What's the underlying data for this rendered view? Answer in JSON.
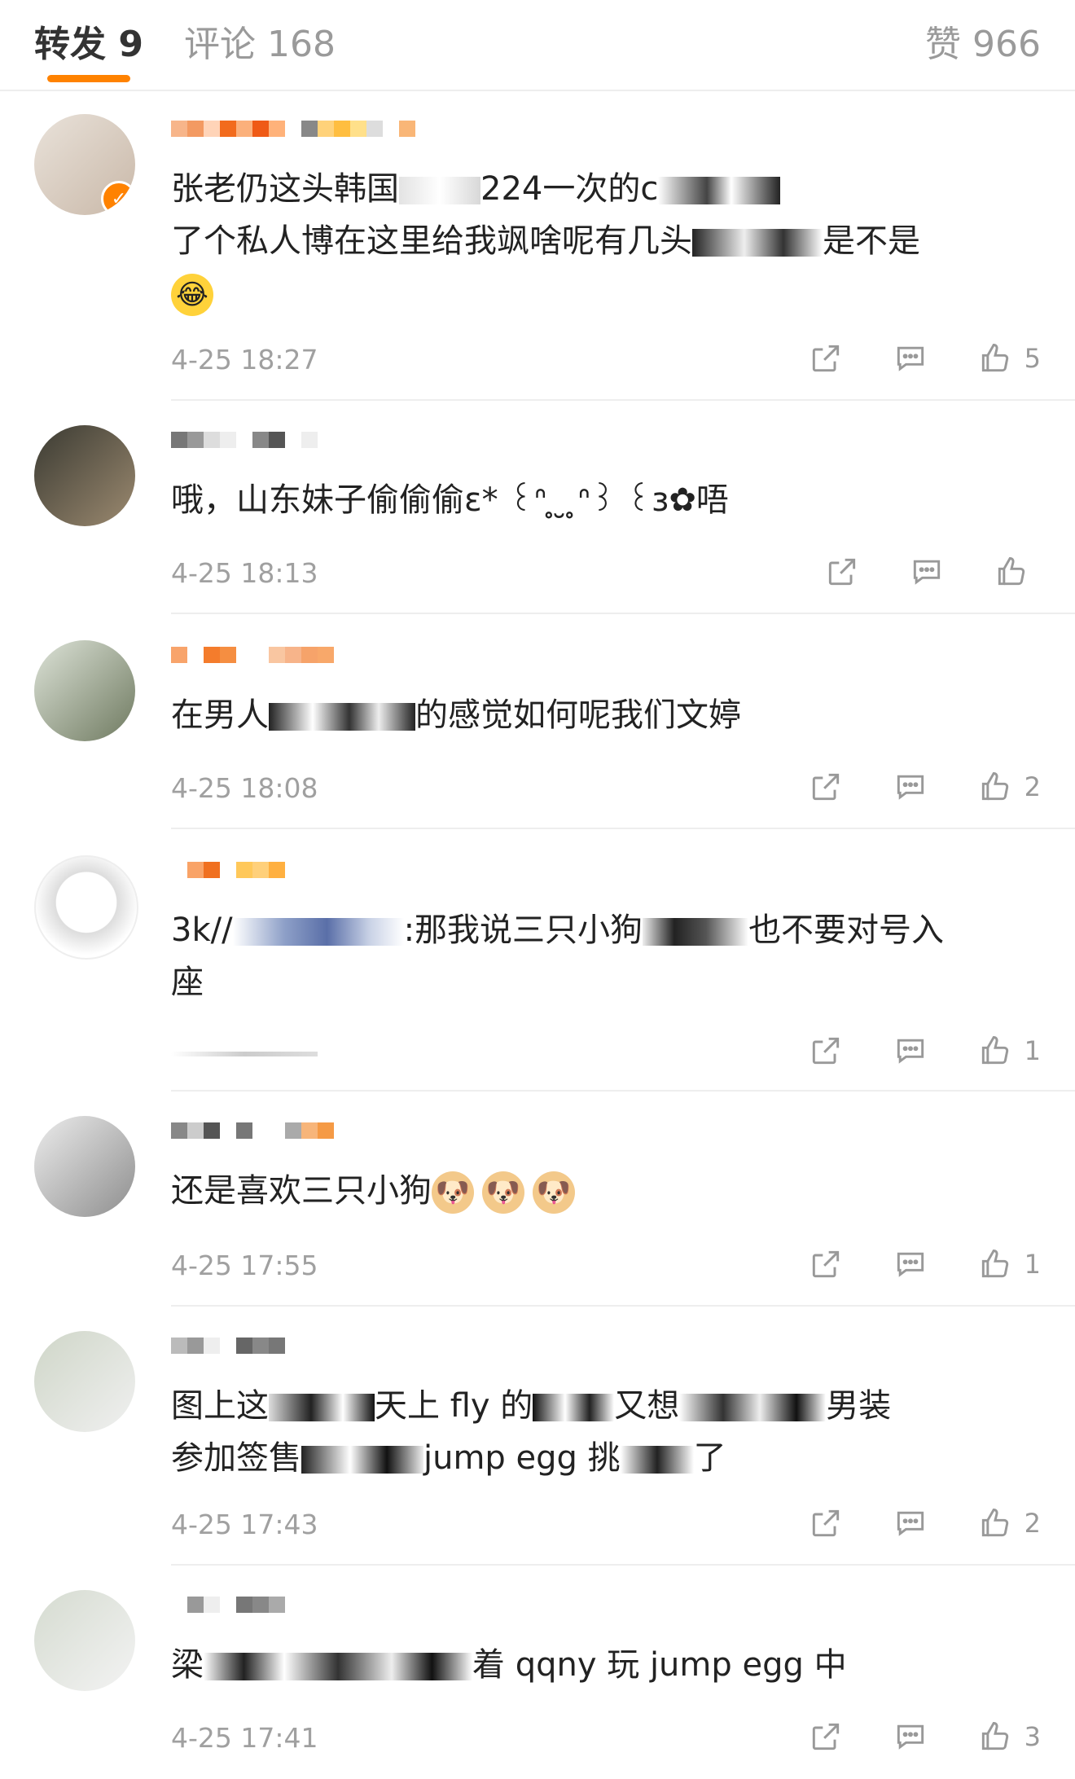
{
  "tabs": {
    "repost": "转发 9",
    "comment": "评论 168",
    "like": "赞 966"
  },
  "comments": [
    {
      "text_a": "张老仍这头韩国",
      "text_b": "224一次的c",
      "text_c": "了个私人博在这里给我飒啥呢有几头",
      "text_d": "是不是",
      "time": "4-25 18:27",
      "like_count": "5",
      "emoji": "😂"
    },
    {
      "text": "哦，山东妹子偷偷偷ε* ꒰ᐢ ̥ ̮ ̥ᐢ꒱ ꒰ɜ✿唔",
      "time": "4-25 18:13",
      "like_count": ""
    },
    {
      "text_a": "在男人",
      "text_b": "的感觉如何呢我们文婷",
      "time": "4-25 18:08",
      "like_count": "2"
    },
    {
      "text_a": "3k//",
      "text_b": ":那我说三只小狗",
      "text_c": "也不要对号入",
      "text_d": "座",
      "like_count": "1"
    },
    {
      "text": "还是喜欢三只小狗",
      "time": "4-25 17:55",
      "like_count": "1",
      "emoji": "🐶"
    },
    {
      "text_a": "图上这",
      "text_b": "天上 fly 的",
      "text_c": "又想",
      "text_d": "男装",
      "text_e": "参加签售",
      "text_f": "jump egg 挑",
      "text_g": "了",
      "time": "4-25 17:43",
      "like_count": "2"
    },
    {
      "text_a": "梁",
      "text_b": "着 qqny 玩 jump egg 中",
      "time": "4-25 17:41",
      "like_count": "3"
    }
  ],
  "colors": {
    "accent": "#ff8200",
    "time": "#a0a0a0",
    "divider": "#eeeeee"
  },
  "icons": [
    "share-icon",
    "comment-icon",
    "like-icon",
    "verified-icon"
  ]
}
